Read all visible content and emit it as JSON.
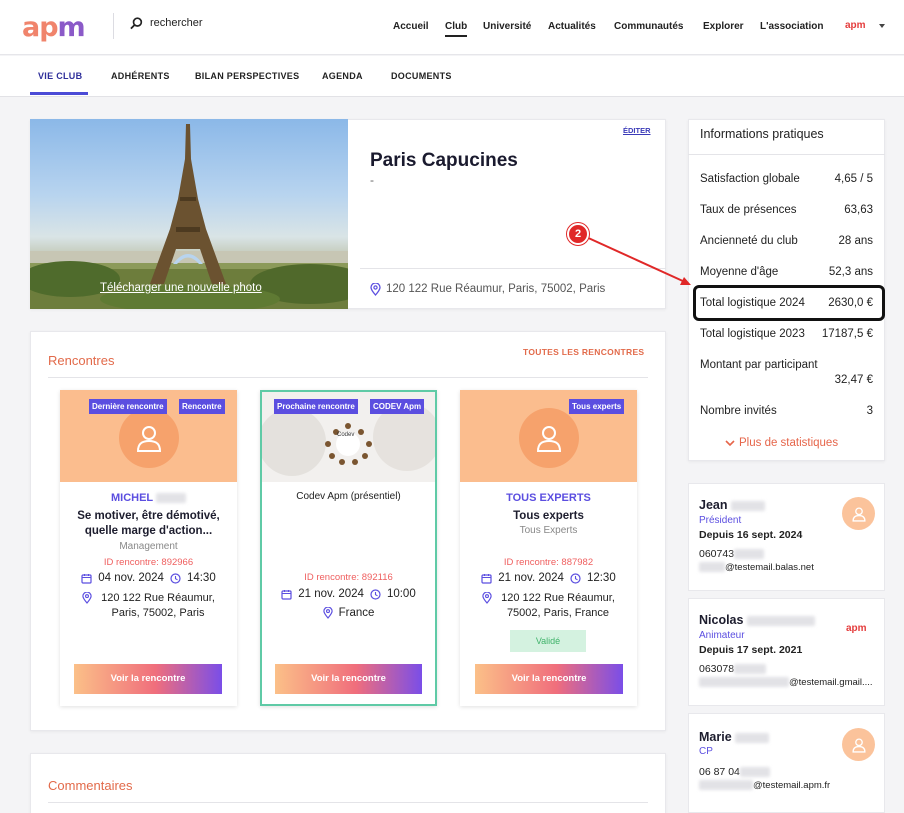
{
  "header": {
    "logo_text": "apm",
    "search_placeholder": "rechercher",
    "nav": [
      "Accueil",
      "Club",
      "Université",
      "Actualités",
      "Communautés",
      "Explorer",
      "L'association"
    ],
    "user_logo": "apm"
  },
  "subnav": {
    "tabs": [
      "VIE CLUB",
      "ADHÉRENTS",
      "BILAN PERSPECTIVES",
      "AGENDA",
      "DOCUMENTS"
    ]
  },
  "club": {
    "upload_photo": "Télécharger une nouvelle photo",
    "edit": "ÉDITER",
    "name": "Paris Capucines",
    "subtitle": "-",
    "address": "120 122 Rue Réaumur, Paris, 75002, Paris"
  },
  "rencontres": {
    "title": "Rencontres",
    "all_link": "TOUTES LES RENCONTRES",
    "cards": [
      {
        "badges": [
          "Dernière rencontre",
          "Rencontre"
        ],
        "name": "MICHEL",
        "title": "Se motiver, être démotivé, quelle marge d'action...",
        "category": "Management",
        "id": "ID rencontre: 892966",
        "date": "04 nov. 2024",
        "time": "14:30",
        "address": "120 122 Rue Réaumur, Paris, 75002, Paris",
        "button": "Voir la rencontre"
      },
      {
        "badges": [
          "Prochaine rencontre",
          "CODEV Apm"
        ],
        "image_label": "Codev",
        "title": "Codev Apm (présentiel)",
        "id": "ID rencontre: 892116",
        "date": "21 nov. 2024",
        "time": "10:00",
        "address": "France",
        "button": "Voir la rencontre"
      },
      {
        "badges": [
          "Tous experts"
        ],
        "name": "TOUS EXPERTS",
        "title": "Tous experts",
        "category": "Tous Experts",
        "id": "ID rencontre: 887982",
        "date": "21 nov. 2024",
        "time": "12:30",
        "address": "120 122 Rue Réaumur, 75002, Paris, France",
        "status": "Validé",
        "button": "Voir la rencontre"
      }
    ]
  },
  "comments": {
    "title": "Commentaires"
  },
  "info": {
    "title": "Informations pratiques",
    "stats": [
      {
        "label": "Satisfaction globale",
        "value": "4,65 / 5"
      },
      {
        "label": "Taux de présences",
        "value": "63,63"
      },
      {
        "label": "Ancienneté du club",
        "value": "28 ans"
      },
      {
        "label": "Moyenne d'âge",
        "value": "52,3 ans"
      },
      {
        "label": "Total logistique 2024",
        "value": "2630,0 €"
      },
      {
        "label": "Total logistique 2023",
        "value": "17187,5 €"
      },
      {
        "label": "Montant par participant",
        "value": "32,47 €"
      },
      {
        "label": "Nombre invités",
        "value": "3"
      }
    ],
    "more": "Plus de statistiques"
  },
  "annotation": {
    "marker": "2"
  },
  "members": [
    {
      "name": "Jean",
      "role": "Président",
      "since": "Depuis 16 sept. 2024",
      "phone": "060743",
      "email": "@testemail.balas.net"
    },
    {
      "name": "Nicolas",
      "role": "Animateur",
      "since": "Depuis 17 sept. 2021",
      "phone": "063078",
      "email": "@testemail.gmail....",
      "logo": "apm"
    },
    {
      "name": "Marie",
      "role": "CP",
      "phone": "06 87 04",
      "email": "@testemail.apm.fr"
    }
  ],
  "colors": {
    "accent": "#5b4ee0",
    "orange": "#e26a4a",
    "peach": "#fbbd8e"
  }
}
